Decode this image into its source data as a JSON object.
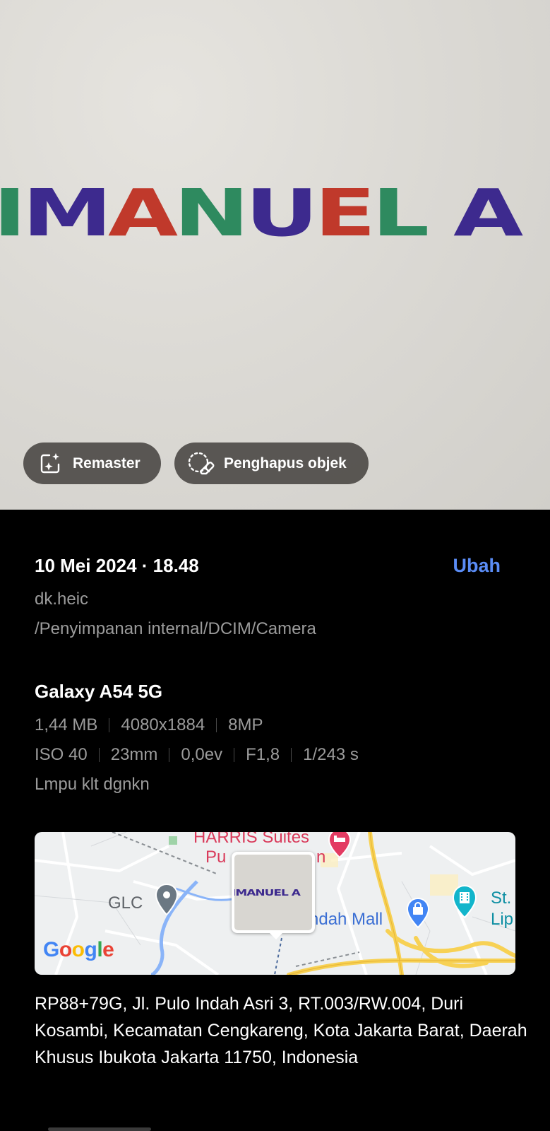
{
  "photo": {
    "text_letters": [
      {
        "ch": "I",
        "color": "#2e8a5f"
      },
      {
        "ch": "M",
        "color": "#3d2a8e"
      },
      {
        "ch": "A",
        "color": "#c0392b"
      },
      {
        "ch": "N",
        "color": "#2e8a5f"
      },
      {
        "ch": "U",
        "color": "#3d2a8e"
      },
      {
        "ch": "E",
        "color": "#c0392b"
      },
      {
        "ch": "L",
        "color": "#2e8a5f"
      },
      {
        "ch": " ",
        "color": "#000000"
      },
      {
        "ch": "A",
        "color": "#3d2a8e"
      }
    ]
  },
  "actions": {
    "remaster_label": "Remaster",
    "remaster_icon": "sparkle-frame-icon",
    "eraser_label": "Penghapus objek",
    "eraser_icon": "eraser-icon"
  },
  "details": {
    "date": "10 Mei 2024 · 18.48",
    "edit_label": "Ubah",
    "filename": "dk.heic",
    "path": "/Penyimpanan internal/DCIM/Camera",
    "device": "Galaxy A54 5G",
    "file_specs": [
      "1,44 MB",
      "4080x1884",
      "8MP"
    ],
    "camera_specs": [
      "ISO 40",
      "23mm",
      "0,0ev",
      "F1,8",
      "1/243 s"
    ],
    "flash": "Lmpu klt dgnkn"
  },
  "map": {
    "place_hotel": "HARRIS Suites",
    "place_hotel_2": "Pu",
    "place_hotel_3": "n",
    "place_glc": "GLC",
    "place_mall": "ndah Mall",
    "place_st": "St.",
    "place_lip": "Lip",
    "thumb_text": "IMANUEL A",
    "google": [
      "G",
      "o",
      "o",
      "g",
      "l",
      "e"
    ],
    "colors": {
      "hotel": "#e33b62",
      "mall": "#4285f4",
      "park": "#12b5cb",
      "road": "#f7d154"
    }
  },
  "address": "RP88+79G, Jl. Pulo Indah Asri 3, RT.003/RW.004, Duri Kosambi, Kecamatan Cengkareng, Kota Jakarta Barat, Daerah Khusus Ibukota Jakarta 11750, Indonesia"
}
